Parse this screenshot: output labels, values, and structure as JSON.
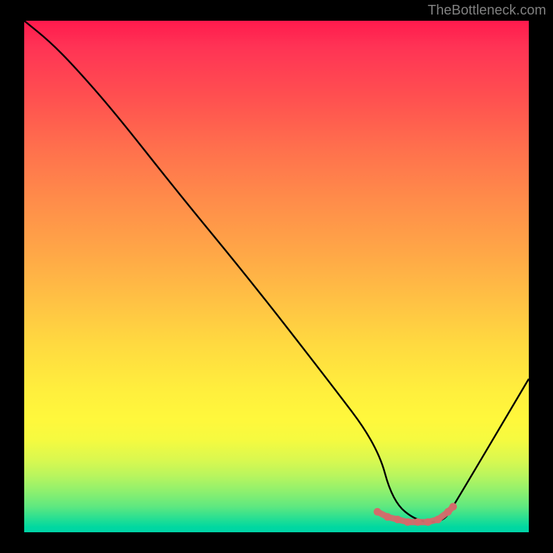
{
  "watermark": "TheBottleneck.com",
  "chart_data": {
    "type": "line",
    "title": "",
    "xlabel": "",
    "ylabel": "",
    "xlim": [
      0,
      100
    ],
    "ylim": [
      0,
      100
    ],
    "series": [
      {
        "name": "bottleneck-curve",
        "color": "#000000",
        "x": [
          0,
          5,
          10,
          18,
          30,
          45,
          60,
          70,
          73,
          78,
          83,
          85,
          100
        ],
        "y": [
          100,
          96,
          91,
          82,
          67,
          49,
          30,
          17,
          6,
          2,
          2,
          5,
          30
        ]
      }
    ],
    "markers": {
      "name": "highlight-range",
      "color": "#d36b6b",
      "points": [
        {
          "x": 70,
          "y": 4
        },
        {
          "x": 72,
          "y": 3
        },
        {
          "x": 74,
          "y": 2.5
        },
        {
          "x": 76,
          "y": 2
        },
        {
          "x": 78,
          "y": 2
        },
        {
          "x": 80,
          "y": 2
        },
        {
          "x": 82,
          "y": 2.5
        },
        {
          "x": 84,
          "y": 4
        },
        {
          "x": 85,
          "y": 5
        }
      ]
    }
  }
}
